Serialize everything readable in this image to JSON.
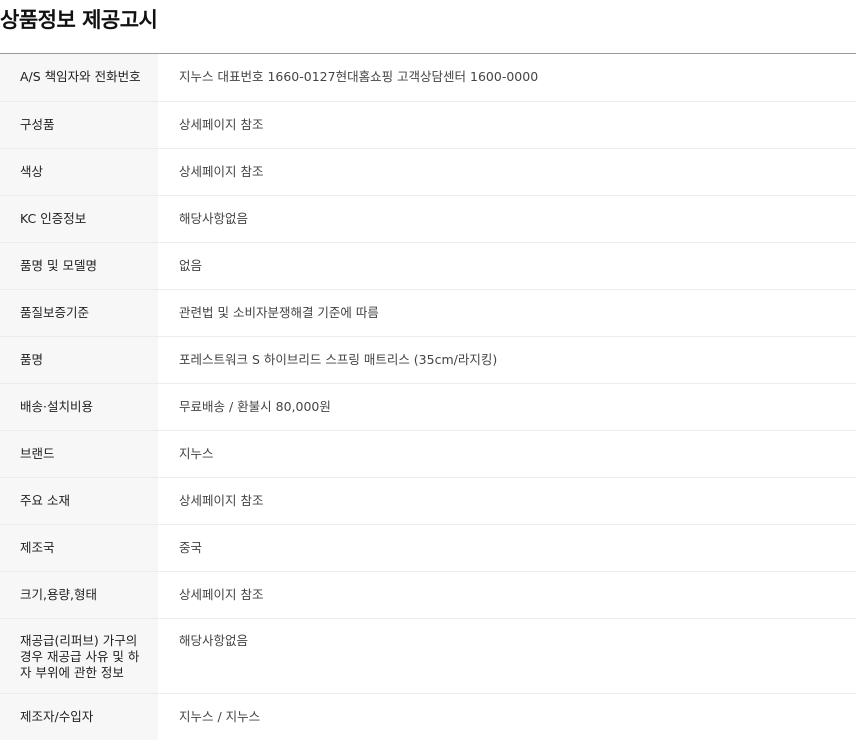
{
  "title": "상품정보 제공고시",
  "rows": [
    {
      "label": "A/S 책임자와 전화번호",
      "value": "지누스 대표번호 1660-0127현대홈쇼핑 고객상담센터 1600-0000"
    },
    {
      "label": "구성품",
      "value": "상세페이지 참조"
    },
    {
      "label": "색상",
      "value": "상세페이지 참조"
    },
    {
      "label": "KC 인증정보",
      "value": "해당사항없음"
    },
    {
      "label": "품명 및 모델명",
      "value": "없음"
    },
    {
      "label": "품질보증기준",
      "value": "관련법 및 소비자분쟁해결 기준에 따름"
    },
    {
      "label": "품명",
      "value": "포레스트워크 S 하이브리드 스프링 매트리스 (35cm/라지킹)"
    },
    {
      "label": "배송·설치비용",
      "value": "무료배송 / 환불시 80,000원"
    },
    {
      "label": "브랜드",
      "value": "지누스"
    },
    {
      "label": "주요 소재",
      "value": "상세페이지 참조"
    },
    {
      "label": "제조국",
      "value": "중국"
    },
    {
      "label": "크기,용량,형태",
      "value": "상세페이지 참조"
    },
    {
      "label": "재공급(리퍼브) 가구의 경우 재공급 사유 및 하자 부위에 관한 정보",
      "value": "해당사항없음"
    },
    {
      "label": "제조자/수입자",
      "value": "지누스 / 지누스"
    }
  ]
}
